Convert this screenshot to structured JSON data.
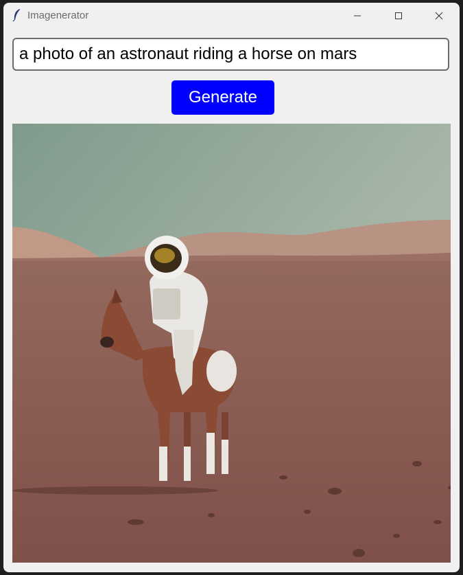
{
  "window": {
    "title": "Imagenerator",
    "app_icon": "feather-icon",
    "controls": [
      "minimize-icon",
      "maximize-icon",
      "close-icon"
    ]
  },
  "prompt": {
    "value": "a photo of an astronaut riding a horse on mars"
  },
  "generate_button": {
    "label": "Generate",
    "background": "#0000ff",
    "text_color": "#ffffff"
  },
  "generated_image": {
    "alt": "a photo of an astronaut riding a horse on mars",
    "sky_color": "#8fa89a",
    "ground_color": "#8a5a4e"
  }
}
